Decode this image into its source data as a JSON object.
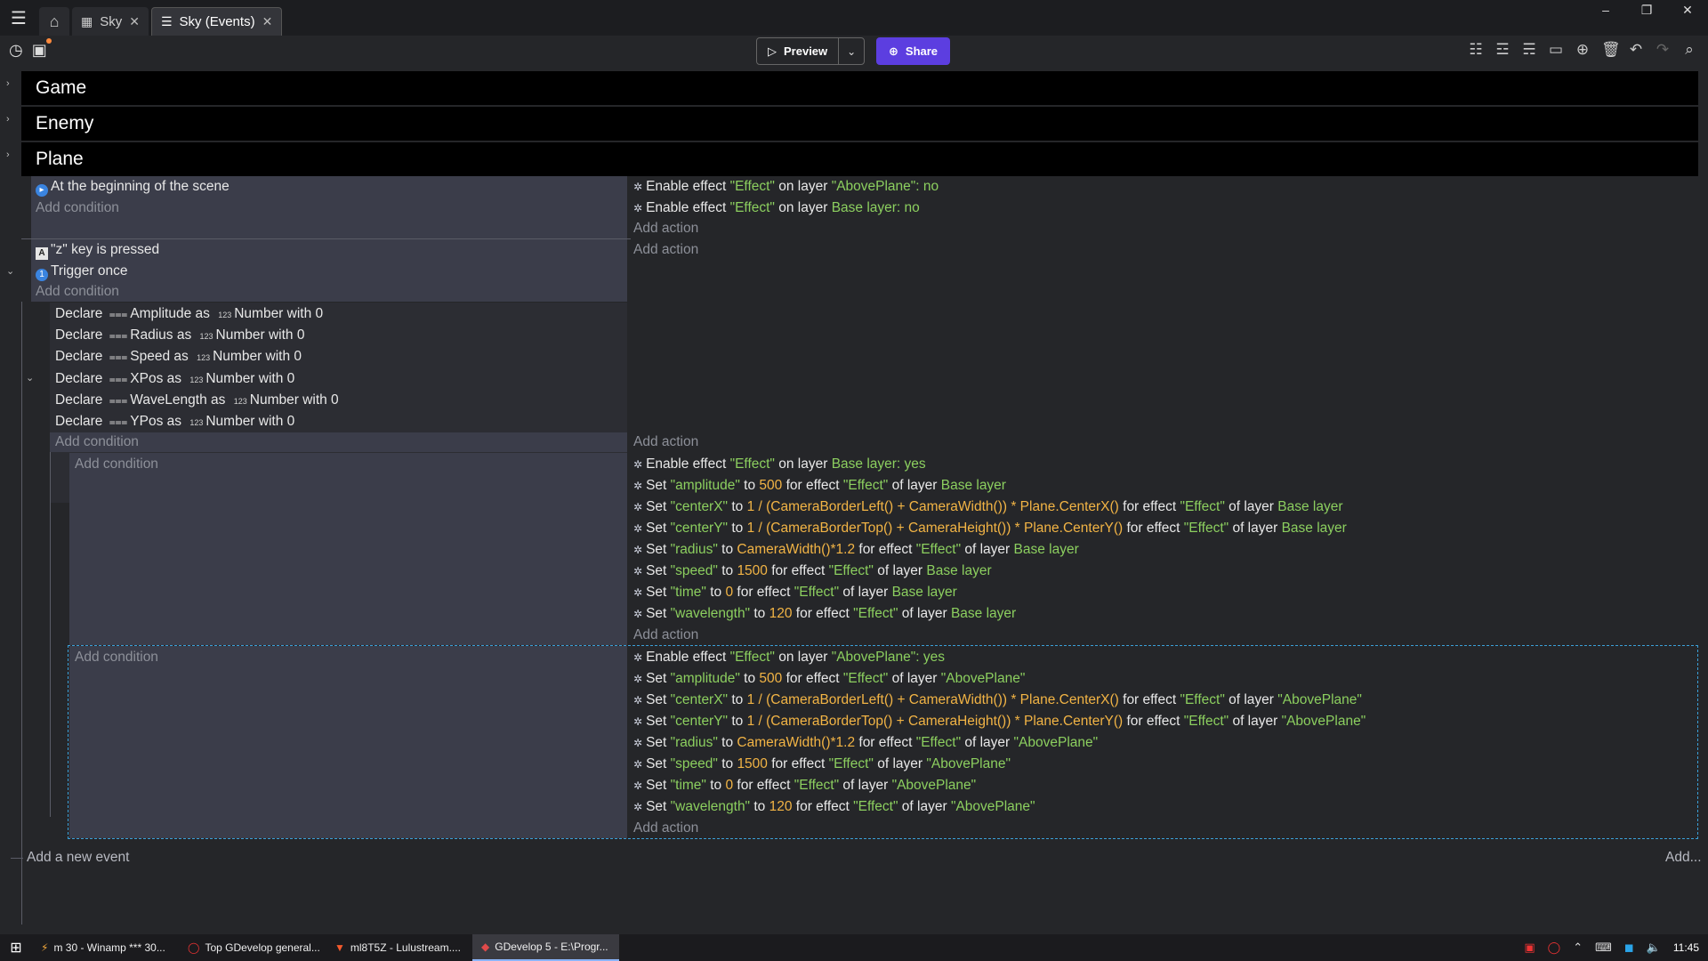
{
  "tabs": [
    {
      "label": "Sky",
      "icon": "film-icon"
    },
    {
      "label": "Sky (Events)",
      "icon": "list-icon"
    }
  ],
  "toolbar": {
    "preview_label": "Preview",
    "share_label": "Share"
  },
  "groups": [
    "Game",
    "Enemy",
    "Plane"
  ],
  "event1": {
    "conditions": [
      "At the beginning of the scene"
    ],
    "add_condition": "Add condition",
    "actions": [
      {
        "pre": "Enable effect ",
        "effect": "\"Effect\"",
        "mid": " on layer ",
        "layer": "\"AbovePlane\": no"
      },
      {
        "pre": "Enable effect ",
        "effect": "\"Effect\"",
        "mid": " on layer ",
        "layer": "Base layer: no"
      }
    ],
    "add_action": "Add action"
  },
  "event2": {
    "cond_key_text": "\"z\"",
    "cond_key_rest": " key is pressed",
    "cond_trigger": "Trigger once",
    "add_condition": "Add condition",
    "add_action": "Add action"
  },
  "variables": {
    "items": [
      {
        "name": "Amplitude",
        "value": "Number with 0"
      },
      {
        "name": "Radius",
        "value": "Number with 0"
      },
      {
        "name": "Speed",
        "value": "Number with 0"
      },
      {
        "name": "XPos",
        "value": "Number with 0"
      },
      {
        "name": "WaveLength",
        "value": "Number with 0"
      },
      {
        "name": "YPos",
        "value": "Number with 0"
      }
    ],
    "declare": "Declare ",
    "as": " as ",
    "add_condition": "Add condition",
    "add_action": "Add action"
  },
  "sub1": {
    "add_condition": "Add condition",
    "add_action": "Add action",
    "enable": {
      "pre": "Enable effect ",
      "effect": "\"Effect\"",
      "mid": " on layer ",
      "layer": "Base layer: yes"
    },
    "sets": [
      {
        "param": "\"amplitude\"",
        "value": "500",
        "layer": "Base layer"
      },
      {
        "param": "\"centerX\"",
        "value": "1 / (CameraBorderLeft() + CameraWidth()) * Plane.CenterX()",
        "layer": "Base layer"
      },
      {
        "param": "\"centerY\"",
        "value": "1 / (CameraBorderTop() + CameraHeight()) * Plane.CenterY()",
        "layer": "Base layer"
      },
      {
        "param": "\"radius\"",
        "value": "CameraWidth()*1.2",
        "layer": "Base layer"
      },
      {
        "param": "\"speed\"",
        "value": "1500",
        "layer": "Base layer"
      },
      {
        "param": "\"time\"",
        "value": "0",
        "layer": "Base layer"
      },
      {
        "param": "\"wavelength\"",
        "value": "120",
        "layer": "Base layer"
      }
    ]
  },
  "sub2": {
    "add_condition": "Add condition",
    "add_action": "Add action",
    "enable": {
      "pre": "Enable effect ",
      "effect": "\"Effect\"",
      "mid": " on layer ",
      "layer": "\"AbovePlane\": yes"
    },
    "sets": [
      {
        "param": "\"amplitude\"",
        "value": "500",
        "layer": "\"AbovePlane\""
      },
      {
        "param": "\"centerX\"",
        "value": "1 / (CameraBorderLeft() + CameraWidth()) * Plane.CenterX()",
        "layer": "\"AbovePlane\""
      },
      {
        "param": "\"centerY\"",
        "value": "1 / (CameraBorderTop() + CameraHeight()) * Plane.CenterY()",
        "layer": "\"AbovePlane\""
      },
      {
        "param": "\"radius\"",
        "value": "CameraWidth()*1.2",
        "layer": "\"AbovePlane\""
      },
      {
        "param": "\"speed\"",
        "value": "1500",
        "layer": "\"AbovePlane\""
      },
      {
        "param": "\"time\"",
        "value": "0",
        "layer": "\"AbovePlane\""
      },
      {
        "param": "\"wavelength\"",
        "value": "120",
        "layer": "\"AbovePlane\""
      }
    ]
  },
  "set_words": {
    "set": "Set ",
    "to": " to ",
    "for_effect": " for effect ",
    "effect": "\"Effect\"",
    "of_layer": " of layer "
  },
  "footer": {
    "add_event": "Add a new event",
    "add_more": "Add..."
  },
  "taskbar": {
    "items": [
      "m 30 - Winamp *** 30...",
      "Top GDevelop general...",
      "ml8T5Z - Lulustream....",
      "GDevelop 5 - E:\\Progr..."
    ],
    "clock": "11:45"
  }
}
